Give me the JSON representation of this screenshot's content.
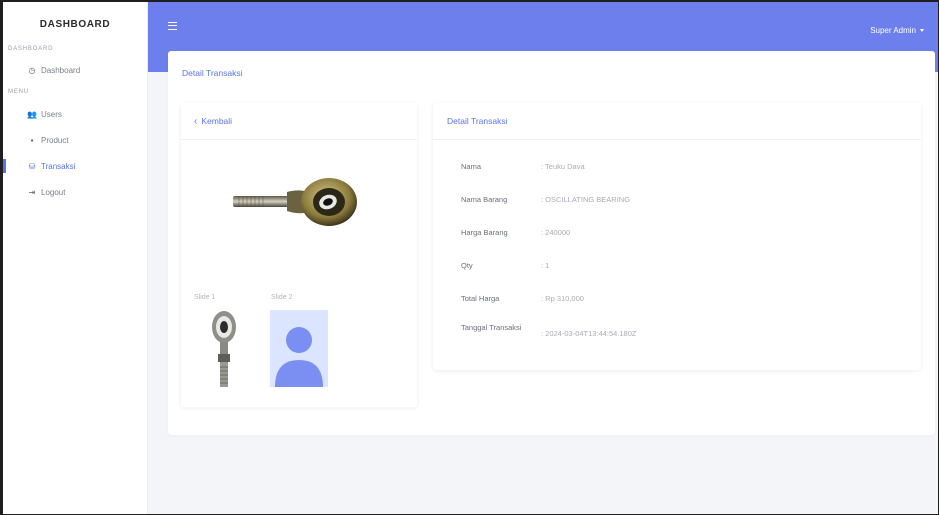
{
  "sidebar": {
    "brand": "DASHBOARD",
    "sections": [
      {
        "heading": "DASHBOARD",
        "items": [
          {
            "label": "Dashboard",
            "icon": "clock-icon"
          }
        ]
      },
      {
        "heading": "MENU",
        "items": [
          {
            "label": "Users",
            "icon": "users-icon"
          },
          {
            "label": "Product",
            "icon": "box-icon"
          },
          {
            "label": "Transaksi",
            "icon": "database-icon",
            "active": true
          },
          {
            "label": "Logout",
            "icon": "logout-icon"
          }
        ]
      }
    ]
  },
  "topbar": {
    "user_label": "Super Admin"
  },
  "main": {
    "title": "Detail Transaksi",
    "back_label": "Kembali",
    "slides": [
      "Slide 1",
      "Slide 2"
    ],
    "detail": {
      "title": "Detail Transaksi",
      "rows": [
        {
          "label": "Nama",
          "value": ": Teuku Dava"
        },
        {
          "label": "Nama Barang",
          "value": ": OSCILLATING BEARING"
        },
        {
          "label": "Harga Barang",
          "value": ": 240000"
        },
        {
          "label": "Qty",
          "value": ": 1"
        },
        {
          "label": "Total Harga",
          "value": ": Rp 310,000"
        },
        {
          "label": "Tanggal Transaksi",
          "value": ": 2024-03-04T13:44:54.180Z"
        }
      ]
    }
  },
  "colors": {
    "accent": "#5b73e8",
    "topbar": "#6d7fec",
    "background": "#f3f5f9"
  }
}
